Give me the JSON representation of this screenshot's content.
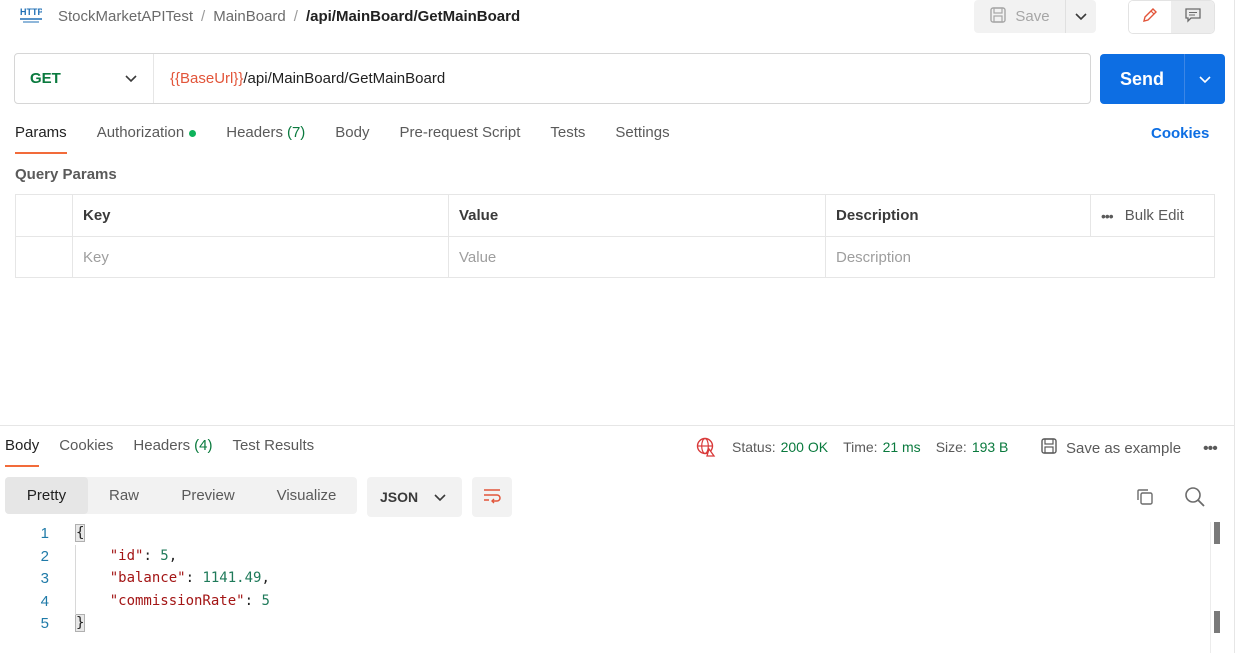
{
  "breadcrumb": {
    "icon": "http-icon",
    "collection": "StockMarketAPITest",
    "sep1": "/",
    "folder": "MainBoard",
    "sep2": "/",
    "request": "/api/MainBoard/GetMainBoard"
  },
  "toolbar": {
    "save_label": "Save"
  },
  "request": {
    "method": "GET",
    "url_variable": "{{BaseUrl}}",
    "url_path": "/api/MainBoard/GetMainBoard",
    "send_label": "Send"
  },
  "request_tabs": {
    "params": "Params",
    "authorization": "Authorization",
    "headers": "Headers",
    "headers_count": "(7)",
    "body": "Body",
    "prerequest": "Pre-request Script",
    "tests": "Tests",
    "settings": "Settings",
    "cookies": "Cookies"
  },
  "query_params": {
    "title": "Query Params",
    "columns": {
      "key": "Key",
      "value": "Value",
      "description": "Description"
    },
    "bulk_edit": "Bulk Edit",
    "placeholders": {
      "key": "Key",
      "value": "Value",
      "description": "Description"
    }
  },
  "response_tabs": {
    "body": "Body",
    "cookies": "Cookies",
    "headers": "Headers",
    "headers_count": "(4)",
    "test_results": "Test Results"
  },
  "response_meta": {
    "status_label": "Status:",
    "status_value": "200 OK",
    "time_label": "Time:",
    "time_value": "21 ms",
    "size_label": "Size:",
    "size_value": "193 B",
    "save_example": "Save as example"
  },
  "view_modes": {
    "pretty": "Pretty",
    "raw": "Raw",
    "preview": "Preview",
    "visualize": "Visualize"
  },
  "format": {
    "selected": "JSON"
  },
  "code": {
    "line_numbers": [
      "1",
      "2",
      "3",
      "4",
      "5"
    ],
    "open_brace": "{",
    "close_brace": "}",
    "entries": [
      {
        "key": "\"id\"",
        "colon": ": ",
        "value": "5",
        "comma": ","
      },
      {
        "key": "\"balance\"",
        "colon": ": ",
        "value": "1141.49",
        "comma": ","
      },
      {
        "key": "\"commissionRate\"",
        "colon": ": ",
        "value": "5",
        "comma": ""
      }
    ]
  },
  "colors": {
    "accent": "#f26b3a",
    "send": "#0d6ee3",
    "method_get": "#0a7a3e",
    "url_variable": "#e2553a",
    "auth_dot": "#0eb35b"
  }
}
